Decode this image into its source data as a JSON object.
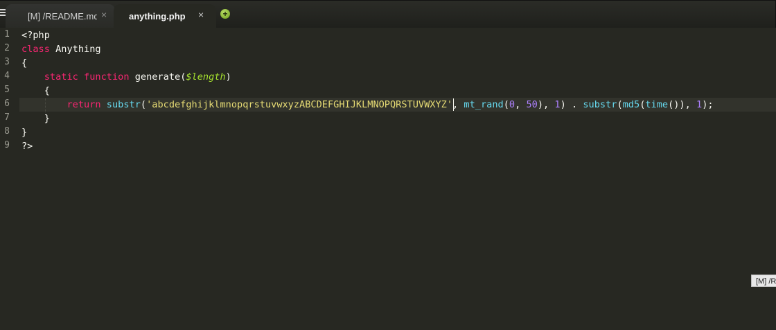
{
  "tabs": [
    {
      "label": "[M] /README.md",
      "close": "×",
      "active": false
    },
    {
      "label": "anything.php",
      "close": "×",
      "active": true
    }
  ],
  "new_tab_label": "+",
  "icons": {
    "menu": "hamburger-icon",
    "new_tab": "plus-circle-icon",
    "close": "close-icon"
  },
  "colors": {
    "background": "#272822",
    "keyword": "#f92672",
    "function": "#66d9ef",
    "variable": "#a6e22e",
    "string": "#e6db74",
    "number": "#ae81ff",
    "text": "#f8f8f2"
  },
  "line_numbers": [
    "1",
    "2",
    "3",
    "4",
    "5",
    "6",
    "7",
    "8",
    "9"
  ],
  "code": {
    "l1": {
      "t1": "<?php"
    },
    "l2": {
      "kw": "class",
      "t1": " Anything"
    },
    "l3": {
      "t1": "{"
    },
    "l4": {
      "t0": "    ",
      "kw1": "static",
      "sp": " ",
      "kw2": "function",
      "t1": " generate(",
      "var": "$length",
      "t2": ")"
    },
    "l5": {
      "t1": "    {"
    },
    "l6": {
      "t0": "        ",
      "kw": "return",
      "sp": " ",
      "fn1": "substr",
      "p1": "(",
      "str": "'abcdefghijklmnopqrstuvwxyzABCDEFGHIJKLMNOPQRSTUVWXYZ'",
      "p2": ", ",
      "fn2": "mt_rand",
      "p3": "(",
      "n1": "0",
      "p4": ", ",
      "n2": "50",
      "p5": "), ",
      "n3": "1",
      "p6": ") . ",
      "fn3": "substr",
      "p7": "(",
      "fn4": "md5",
      "p8": "(",
      "fn5": "time",
      "p9": "()), ",
      "n4": "1",
      "p10": ");"
    },
    "l7": {
      "t1": "    }"
    },
    "l8": {
      "t1": "}"
    },
    "l9": {
      "t1": "?>"
    }
  },
  "tooltip": "[M] /README.md"
}
